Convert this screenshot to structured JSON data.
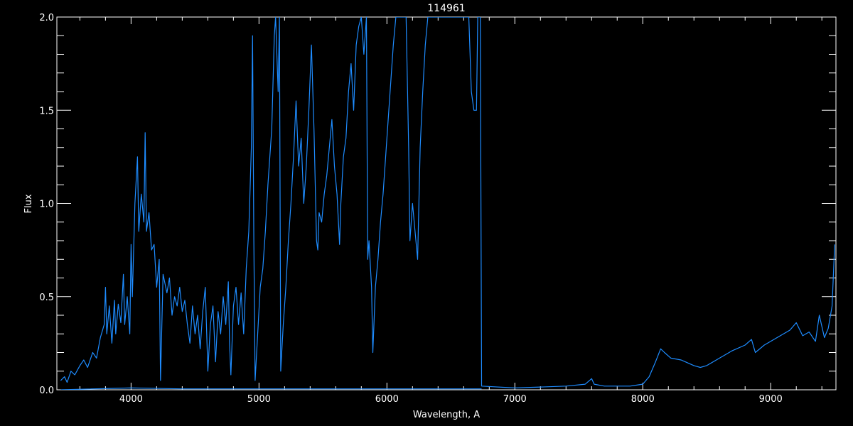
{
  "chart_data": {
    "type": "line",
    "title": "114961",
    "xlabel": "Wavelength, A",
    "ylabel": "Flux",
    "xlim": [
      3420,
      9510
    ],
    "ylim": [
      0,
      2.0
    ],
    "x_ticks": [
      4000,
      5000,
      6000,
      7000,
      8000,
      9000
    ],
    "y_ticks": [
      0.0,
      0.5,
      1.0,
      1.5,
      2.0
    ],
    "y_tick_labels": [
      "0.0",
      "0.5",
      "1.0",
      "1.5",
      "2.0"
    ],
    "x_minor_step": 200,
    "y_minor_step": 0.1,
    "grid": false,
    "legend": "none",
    "colors": {
      "background": "#000000",
      "axes": "#ffffff",
      "series": "#1e8cff"
    },
    "series": [
      {
        "values_xy": [
          [
            3450,
            0.05
          ],
          [
            3480,
            0.07
          ],
          [
            3500,
            0.04
          ],
          [
            3530,
            0.1
          ],
          [
            3560,
            0.08
          ],
          [
            3600,
            0.13
          ],
          [
            3630,
            0.16
          ],
          [
            3660,
            0.12
          ],
          [
            3700,
            0.2
          ],
          [
            3730,
            0.17
          ],
          [
            3760,
            0.28
          ],
          [
            3790,
            0.35
          ],
          [
            3800,
            0.55
          ],
          [
            3810,
            0.3
          ],
          [
            3830,
            0.45
          ],
          [
            3850,
            0.25
          ],
          [
            3870,
            0.48
          ],
          [
            3880,
            0.3
          ],
          [
            3900,
            0.46
          ],
          [
            3920,
            0.36
          ],
          [
            3940,
            0.62
          ],
          [
            3950,
            0.35
          ],
          [
            3970,
            0.5
          ],
          [
            3990,
            0.3
          ],
          [
            4000,
            0.78
          ],
          [
            4010,
            0.5
          ],
          [
            4030,
            1.0
          ],
          [
            4050,
            1.25
          ],
          [
            4060,
            0.85
          ],
          [
            4080,
            1.05
          ],
          [
            4100,
            0.9
          ],
          [
            4110,
            1.38
          ],
          [
            4120,
            0.85
          ],
          [
            4140,
            0.95
          ],
          [
            4160,
            0.75
          ],
          [
            4180,
            0.78
          ],
          [
            4200,
            0.55
          ],
          [
            4220,
            0.7
          ],
          [
            4230,
            0.05
          ],
          [
            4250,
            0.62
          ],
          [
            4280,
            0.52
          ],
          [
            4300,
            0.6
          ],
          [
            4320,
            0.4
          ],
          [
            4340,
            0.5
          ],
          [
            4360,
            0.45
          ],
          [
            4380,
            0.55
          ],
          [
            4400,
            0.42
          ],
          [
            4420,
            0.48
          ],
          [
            4440,
            0.35
          ],
          [
            4460,
            0.25
          ],
          [
            4480,
            0.45
          ],
          [
            4500,
            0.3
          ],
          [
            4520,
            0.4
          ],
          [
            4540,
            0.22
          ],
          [
            4560,
            0.42
          ],
          [
            4580,
            0.55
          ],
          [
            4600,
            0.1
          ],
          [
            4620,
            0.35
          ],
          [
            4640,
            0.45
          ],
          [
            4660,
            0.15
          ],
          [
            4680,
            0.42
          ],
          [
            4700,
            0.3
          ],
          [
            4720,
            0.5
          ],
          [
            4740,
            0.35
          ],
          [
            4760,
            0.58
          ],
          [
            4770,
            0.25
          ],
          [
            4780,
            0.08
          ],
          [
            4800,
            0.45
          ],
          [
            4820,
            0.55
          ],
          [
            4840,
            0.35
          ],
          [
            4860,
            0.52
          ],
          [
            4880,
            0.3
          ],
          [
            4900,
            0.65
          ],
          [
            4920,
            0.85
          ],
          [
            4940,
            1.3
          ],
          [
            4950,
            1.9
          ],
          [
            4960,
            0.8
          ],
          [
            4970,
            0.05
          ],
          [
            4990,
            0.3
          ],
          [
            5010,
            0.55
          ],
          [
            5030,
            0.65
          ],
          [
            5050,
            0.85
          ],
          [
            5070,
            1.1
          ],
          [
            5100,
            1.4
          ],
          [
            5120,
            1.9
          ],
          [
            5130,
            2.0
          ],
          [
            5150,
            1.6
          ],
          [
            5160,
            2.0
          ],
          [
            5170,
            0.1
          ],
          [
            5190,
            0.35
          ],
          [
            5210,
            0.55
          ],
          [
            5230,
            0.8
          ],
          [
            5250,
            1.0
          ],
          [
            5270,
            1.25
          ],
          [
            5290,
            1.55
          ],
          [
            5310,
            1.2
          ],
          [
            5330,
            1.35
          ],
          [
            5350,
            1.0
          ],
          [
            5370,
            1.2
          ],
          [
            5390,
            1.5
          ],
          [
            5410,
            1.85
          ],
          [
            5430,
            1.4
          ],
          [
            5450,
            0.8
          ],
          [
            5460,
            0.75
          ],
          [
            5470,
            0.95
          ],
          [
            5490,
            0.9
          ],
          [
            5510,
            1.05
          ],
          [
            5530,
            1.15
          ],
          [
            5550,
            1.3
          ],
          [
            5570,
            1.45
          ],
          [
            5590,
            1.2
          ],
          [
            5610,
            1.05
          ],
          [
            5630,
            0.78
          ],
          [
            5640,
            1.0
          ],
          [
            5660,
            1.25
          ],
          [
            5680,
            1.35
          ],
          [
            5700,
            1.6
          ],
          [
            5720,
            1.75
          ],
          [
            5740,
            1.5
          ],
          [
            5760,
            1.85
          ],
          [
            5780,
            1.95
          ],
          [
            5800,
            2.0
          ],
          [
            5820,
            1.8
          ],
          [
            5840,
            2.0
          ],
          [
            5850,
            0.7
          ],
          [
            5860,
            0.8
          ],
          [
            5880,
            0.55
          ],
          [
            5890,
            0.2
          ],
          [
            5910,
            0.55
          ],
          [
            5930,
            0.7
          ],
          [
            5950,
            0.9
          ],
          [
            5970,
            1.05
          ],
          [
            5990,
            1.25
          ],
          [
            6010,
            1.45
          ],
          [
            6030,
            1.65
          ],
          [
            6050,
            1.85
          ],
          [
            6070,
            2.0
          ],
          [
            6150,
            2.0
          ],
          [
            6170,
            1.3
          ],
          [
            6180,
            0.8
          ],
          [
            6200,
            1.0
          ],
          [
            6220,
            0.85
          ],
          [
            6240,
            0.7
          ],
          [
            6260,
            1.3
          ],
          [
            6280,
            1.6
          ],
          [
            6300,
            1.85
          ],
          [
            6320,
            2.0
          ],
          [
            6640,
            2.0
          ],
          [
            6660,
            1.6
          ],
          [
            6680,
            1.5
          ],
          [
            6700,
            1.5
          ],
          [
            6710,
            2.0
          ],
          [
            6730,
            2.0
          ],
          [
            6740,
            0.02
          ],
          [
            7000,
            0.01
          ],
          [
            7200,
            0.015
          ],
          [
            7400,
            0.02
          ],
          [
            7550,
            0.03
          ],
          [
            7600,
            0.06
          ],
          [
            7620,
            0.03
          ],
          [
            7700,
            0.02
          ],
          [
            7800,
            0.02
          ],
          [
            7900,
            0.02
          ],
          [
            8000,
            0.03
          ],
          [
            8050,
            0.07
          ],
          [
            8100,
            0.15
          ],
          [
            8140,
            0.22
          ],
          [
            8170,
            0.2
          ],
          [
            8220,
            0.17
          ],
          [
            8300,
            0.16
          ],
          [
            8400,
            0.13
          ],
          [
            8450,
            0.12
          ],
          [
            8500,
            0.13
          ],
          [
            8600,
            0.17
          ],
          [
            8700,
            0.21
          ],
          [
            8800,
            0.24
          ],
          [
            8850,
            0.27
          ],
          [
            8880,
            0.2
          ],
          [
            8950,
            0.24
          ],
          [
            9050,
            0.28
          ],
          [
            9150,
            0.32
          ],
          [
            9200,
            0.36
          ],
          [
            9250,
            0.29
          ],
          [
            9300,
            0.31
          ],
          [
            9350,
            0.26
          ],
          [
            9380,
            0.4
          ],
          [
            9420,
            0.28
          ],
          [
            9450,
            0.33
          ],
          [
            9480,
            0.45
          ],
          [
            9500,
            0.78
          ]
        ]
      },
      {
        "values_xy": [
          [
            3450,
            0.0
          ],
          [
            4000,
            0.01
          ],
          [
            4400,
            0.005
          ],
          [
            5000,
            0.005
          ],
          [
            5500,
            0.005
          ],
          [
            6000,
            0.005
          ],
          [
            6500,
            0.005
          ],
          [
            6740,
            0.005
          ]
        ]
      }
    ]
  }
}
